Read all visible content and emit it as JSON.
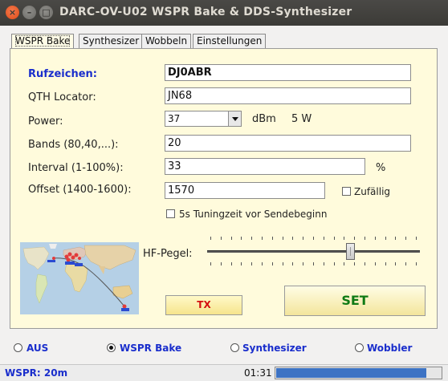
{
  "window": {
    "title": "DARC-OV-U02 WSPR Bake & DDS-Synthesizer"
  },
  "tabs": [
    {
      "label": "WSPR Bake",
      "active": true
    },
    {
      "label": "Synthesizer",
      "active": false
    },
    {
      "label": "Wobbeln",
      "active": false
    },
    {
      "label": "Einstellungen",
      "active": false
    }
  ],
  "form": {
    "callsign_label": "Rufzeichen:",
    "callsign_value": "DJ0ABR",
    "locator_label": "QTH Locator:",
    "locator_value": "JN68",
    "power_label": "Power:",
    "power_value": "37",
    "power_unit": "dBm",
    "power_watts": "5 W",
    "bands_label": "Bands (80,40,...):",
    "bands_value": "20",
    "interval_label": "Interval (1-100%):",
    "interval_value": "33",
    "interval_unit": "%",
    "offset_label": "Offset (1400-1600):",
    "offset_value": "1570",
    "random_label": "Zufällig",
    "random_checked": false,
    "tuning_label": "5s Tuningzeit vor Sendebeginn",
    "tuning_checked": false
  },
  "hf_level": {
    "label": "HF-Pegel:",
    "value_fraction": 0.68
  },
  "buttons": {
    "tx_label": "TX",
    "set_label": "SET"
  },
  "modes": [
    {
      "label": "AUS",
      "selected": false
    },
    {
      "label": "WSPR Bake",
      "selected": true
    },
    {
      "label": "Synthesizer",
      "selected": false
    },
    {
      "label": "Wobbler",
      "selected": false
    }
  ],
  "status": {
    "mode_text": "WSPR: 20m",
    "time": "01:31",
    "progress_fraction": 0.91
  },
  "colors": {
    "panel_bg": "#fffbdc",
    "label_blue": "#1a2ecc",
    "tx_red": "#d41010",
    "set_green": "#0f7a14",
    "progress_blue": "#3d73c4"
  }
}
